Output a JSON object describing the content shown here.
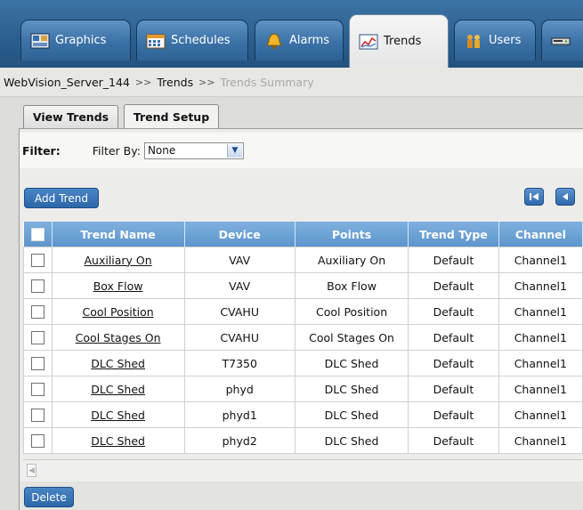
{
  "nav": {
    "tabs": [
      {
        "label": "Graphics",
        "icon": "graphics-icon"
      },
      {
        "label": "Schedules",
        "icon": "schedules-icon"
      },
      {
        "label": "Alarms",
        "icon": "alarm-bell-icon"
      },
      {
        "label": "Trends",
        "icon": "trends-chart-icon",
        "active": true
      },
      {
        "label": "Users",
        "icon": "users-icon"
      },
      {
        "label": "",
        "icon": "devices-icon"
      }
    ]
  },
  "breadcrumb": {
    "server": "WebVision_Server_144",
    "separator": ">>",
    "section": "Trends",
    "current": "Trends Summary"
  },
  "subtabs": [
    {
      "label": "View Trends"
    },
    {
      "label": "Trend Setup",
      "active": true
    }
  ],
  "filter": {
    "label": "Filter:",
    "by_label": "Filter By:",
    "value": "None"
  },
  "buttons": {
    "add_trend": "Add Trend",
    "delete": "Delete"
  },
  "table": {
    "columns": [
      "Trend Name",
      "Device",
      "Points",
      "Trend Type",
      "Channel"
    ],
    "rows": [
      {
        "name": "Auxiliary On",
        "device": "VAV",
        "points": "Auxiliary On",
        "type": "Default",
        "channel": "Channel1"
      },
      {
        "name": "Box Flow",
        "device": "VAV",
        "points": "Box Flow",
        "type": "Default",
        "channel": "Channel1"
      },
      {
        "name": "Cool Position",
        "device": "CVAHU",
        "points": "Cool Position",
        "type": "Default",
        "channel": "Channel1"
      },
      {
        "name": "Cool Stages On",
        "device": "CVAHU",
        "points": "Cool Stages On",
        "type": "Default",
        "channel": "Channel1"
      },
      {
        "name": "DLC Shed",
        "device": "T7350",
        "points": "DLC Shed",
        "type": "Default",
        "channel": "Channel1"
      },
      {
        "name": "DLC Shed",
        "device": "phyd",
        "points": "DLC Shed",
        "type": "Default",
        "channel": "Channel1"
      },
      {
        "name": "DLC Shed",
        "device": "phyd1",
        "points": "DLC Shed",
        "type": "Default",
        "channel": "Channel1"
      },
      {
        "name": "DLC Shed",
        "device": "phyd2",
        "points": "DLC Shed",
        "type": "Default",
        "channel": "Channel1"
      }
    ]
  },
  "colors": {
    "nav_blue": "#2b5e8e",
    "header_blue": "#6ba0d4",
    "button_blue": "#2c67a8"
  }
}
